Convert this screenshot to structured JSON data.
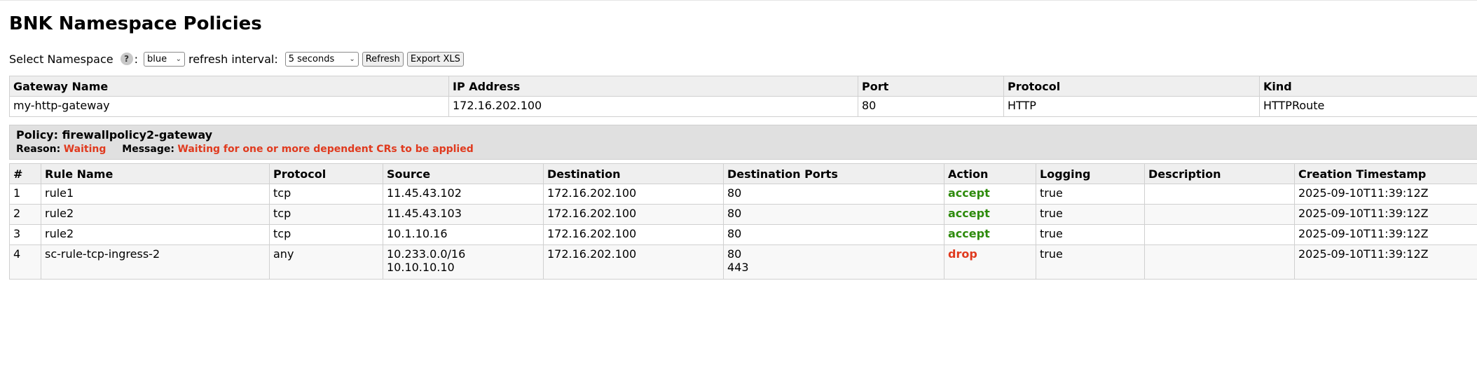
{
  "page_title": "BNK Namespace Policies",
  "controls": {
    "namespace_label": "Select Namespace",
    "help_glyph": "?",
    "colon": ":",
    "namespace_value": "blue",
    "refresh_label": "refresh interval:",
    "refresh_value": "5 seconds",
    "refresh_button": "Refresh",
    "export_button": "Export XLS"
  },
  "gateway": {
    "headers": [
      "Gateway Name",
      "IP Address",
      "Port",
      "Protocol",
      "Kind"
    ],
    "row": [
      "my-http-gateway",
      "172.16.202.100",
      "80",
      "HTTP",
      "HTTPRoute"
    ]
  },
  "policy": {
    "title": "Policy: firewallpolicy2-gateway",
    "reason_label": "Reason:",
    "reason_value": "Waiting",
    "message_label": "Message:",
    "message_value": "Waiting for one or more dependent CRs to be applied"
  },
  "rules": {
    "headers": [
      "#",
      "Rule Name",
      "Protocol",
      "Source",
      "Destination",
      "Destination Ports",
      "Action",
      "Logging",
      "Description",
      "Creation Timestamp"
    ],
    "rows": [
      {
        "num": "1",
        "name": "rule1",
        "protocol": "tcp",
        "source": [
          "11.45.43.102"
        ],
        "destination": "172.16.202.100",
        "ports": [
          "80"
        ],
        "action": "accept",
        "logging": "true",
        "description": "",
        "timestamp": "2025-09-10T11:39:12Z"
      },
      {
        "num": "2",
        "name": "rule2",
        "protocol": "tcp",
        "source": [
          "11.45.43.103"
        ],
        "destination": "172.16.202.100",
        "ports": [
          "80"
        ],
        "action": "accept",
        "logging": "true",
        "description": "",
        "timestamp": "2025-09-10T11:39:12Z"
      },
      {
        "num": "3",
        "name": "rule2",
        "protocol": "tcp",
        "source": [
          "10.1.10.16"
        ],
        "destination": "172.16.202.100",
        "ports": [
          "80"
        ],
        "action": "accept",
        "logging": "true",
        "description": "",
        "timestamp": "2025-09-10T11:39:12Z"
      },
      {
        "num": "4",
        "name": "sc-rule-tcp-ingress-2",
        "protocol": "any",
        "source": [
          "10.233.0.0/16",
          "10.10.10.10"
        ],
        "destination": "172.16.202.100",
        "ports": [
          "80",
          "443"
        ],
        "action": "drop",
        "logging": "true",
        "description": "",
        "timestamp": "2025-09-10T11:39:12Z"
      }
    ]
  },
  "colors": {
    "accept": "#2e8b0c",
    "drop": "#e03a1e",
    "status_red": "#e03a1e",
    "header_bg": "#efefef",
    "policy_bg": "#e0e0e0"
  }
}
